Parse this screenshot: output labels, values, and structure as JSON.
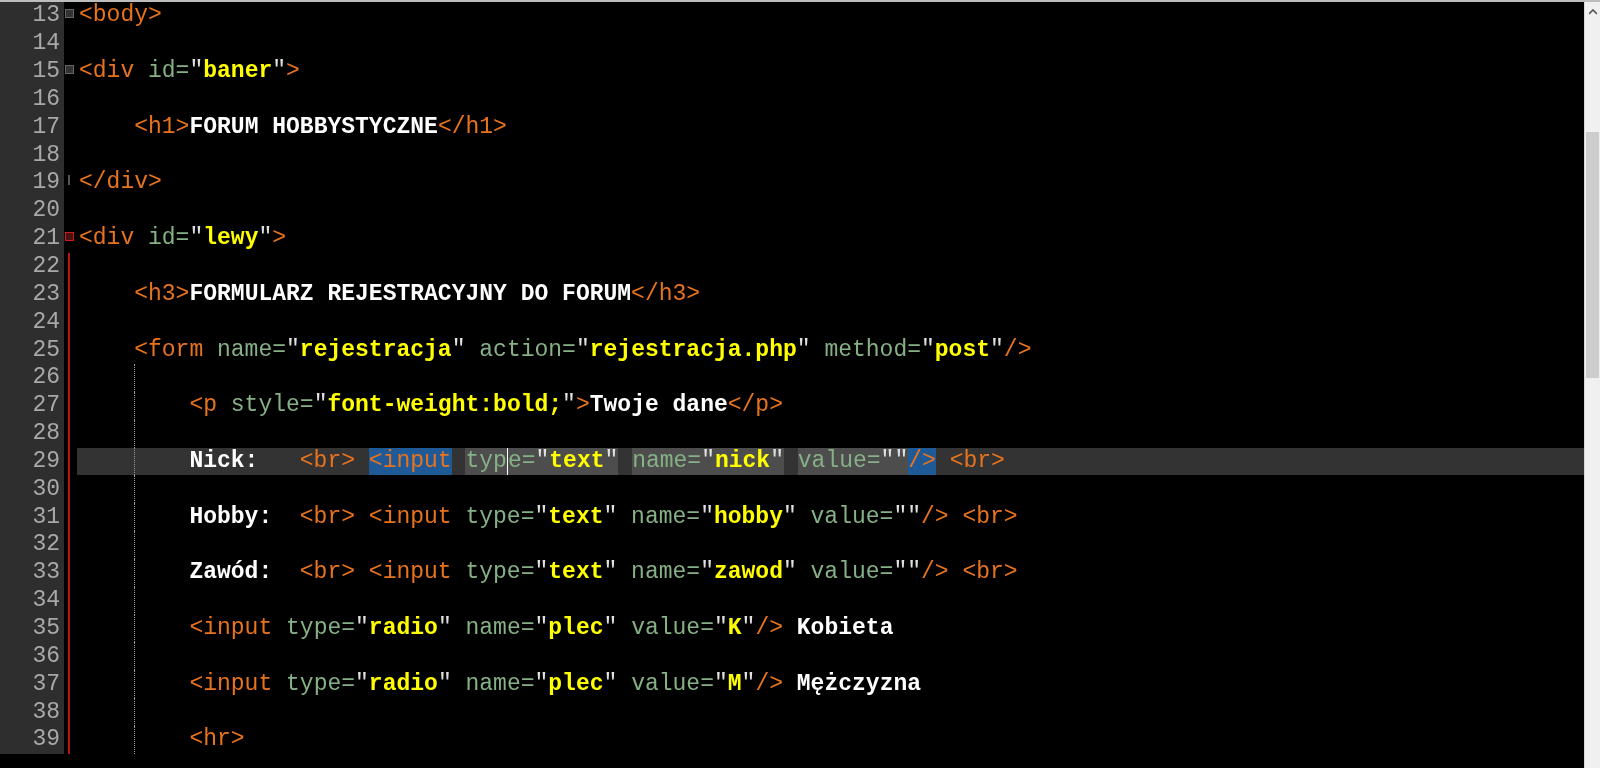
{
  "editor": {
    "lines": [
      {
        "number": "13",
        "kind": "flush",
        "marker": {
          "kind": "fold-start"
        },
        "current": false,
        "guide": false,
        "tokens": [
          {
            "kind": "tag",
            "text": "<body>"
          }
        ]
      },
      {
        "number": "14",
        "current": false,
        "guide": false
      },
      {
        "number": "15",
        "kind": "flush",
        "marker": {
          "kind": "fold-start"
        },
        "current": false,
        "guide": false,
        "tokens": [
          {
            "kind": "tag",
            "text": "<div"
          },
          {
            "kind": "attr",
            "text": "id=",
            "space_before": true
          },
          {
            "kind": "quote",
            "text": "\""
          },
          {
            "kind": "string",
            "text": "baner"
          },
          {
            "kind": "quote",
            "text": "\""
          },
          {
            "kind": "tag",
            "text": ">"
          }
        ]
      },
      {
        "number": "16",
        "current": false,
        "guide": false
      },
      {
        "number": "17",
        "kind": "indented",
        "current": false,
        "guide": false,
        "tokens": [
          {
            "kind": "tag",
            "text": "<h1>"
          },
          {
            "kind": "text",
            "text": "FORUM HOBBYSTYCZNE"
          },
          {
            "kind": "tag",
            "text": "</h1>"
          }
        ]
      },
      {
        "number": "18",
        "current": false,
        "guide": false
      },
      {
        "number": "19",
        "kind": "flush",
        "marker": {
          "kind": "fold-end"
        },
        "current": false,
        "guide": false,
        "tokens": [
          {
            "kind": "tag",
            "text": "</div>"
          }
        ]
      },
      {
        "number": "20",
        "current": false,
        "guide": false
      },
      {
        "number": "21",
        "kind": "flush",
        "marker": {
          "kind": "fold-start-active"
        },
        "current": false,
        "guide": false,
        "tokens": [
          {
            "kind": "tag",
            "text": "<div"
          },
          {
            "kind": "attr",
            "text": "id=",
            "space_before": true
          },
          {
            "kind": "quote",
            "text": "\""
          },
          {
            "kind": "string",
            "text": "lewy"
          },
          {
            "kind": "quote",
            "text": "\""
          },
          {
            "kind": "tag",
            "text": ">"
          }
        ]
      },
      {
        "number": "22",
        "marker": {
          "kind": "fold-body-active"
        },
        "current": false,
        "guide": false
      },
      {
        "number": "23",
        "kind": "indented",
        "marker": {
          "kind": "fold-body-active"
        },
        "current": false,
        "guide": false,
        "tokens": [
          {
            "kind": "tag",
            "text": "<h3>"
          },
          {
            "kind": "text",
            "text": "FORMULARZ REJESTRACYJNY DO FORUM"
          },
          {
            "kind": "tag",
            "text": "</h3>"
          }
        ]
      },
      {
        "number": "24",
        "marker": {
          "kind": "fold-body-active"
        },
        "current": false,
        "guide": false
      },
      {
        "number": "25",
        "kind": "indented",
        "marker": {
          "kind": "fold-body-active"
        },
        "current": false,
        "guide": false,
        "tokens": [
          {
            "kind": "tag",
            "text": "<form"
          },
          {
            "kind": "attr",
            "text": "name=",
            "space_before": true
          },
          {
            "kind": "quote",
            "text": "\""
          },
          {
            "kind": "string",
            "text": "rejestracja"
          },
          {
            "kind": "quote",
            "text": "\""
          },
          {
            "kind": "attr",
            "text": "action=",
            "space_before": true
          },
          {
            "kind": "quote",
            "text": "\""
          },
          {
            "kind": "string",
            "text": "rejestracja.php"
          },
          {
            "kind": "quote",
            "text": "\""
          },
          {
            "kind": "attr",
            "text": "method=",
            "space_before": true
          },
          {
            "kind": "quote",
            "text": "\""
          },
          {
            "kind": "string",
            "text": "post"
          },
          {
            "kind": "quote",
            "text": "\""
          },
          {
            "kind": "tag",
            "text": "/>"
          }
        ]
      },
      {
        "number": "26",
        "marker": {
          "kind": "fold-body-active"
        },
        "current": false,
        "guide": true
      },
      {
        "number": "27",
        "kind": "nested",
        "marker": {
          "kind": "fold-body-active"
        },
        "current": false,
        "guide": true,
        "tokens": [
          {
            "kind": "tag",
            "text": "<p"
          },
          {
            "kind": "attr",
            "text": "style=",
            "space_before": true
          },
          {
            "kind": "quote",
            "text": "\""
          },
          {
            "kind": "string",
            "text": "font-weight:bold;"
          },
          {
            "kind": "quote",
            "text": "\""
          },
          {
            "kind": "tag",
            "text": ">"
          },
          {
            "kind": "text",
            "text": "Twoje dane"
          },
          {
            "kind": "tag",
            "text": "</p>"
          }
        ]
      },
      {
        "number": "28",
        "marker": {
          "kind": "fold-body-active"
        },
        "current": false,
        "guide": true
      },
      {
        "number": "29",
        "kind": "nested",
        "marker": {
          "kind": "fold-body-active"
        },
        "current": true,
        "guide": true,
        "tokens": [
          {
            "kind": "label",
            "text": "Nick:"
          },
          {
            "kind": "tag",
            "text": "<br>"
          },
          {
            "kind": "tag",
            "text": "<input",
            "space_before": true,
            "matched": true
          },
          {
            "kind": "attr",
            "text": "typ",
            "space_before": true,
            "highlighted": true,
            "caret": true
          },
          {
            "kind": "attr",
            "text": "e=",
            "highlighted": true
          },
          {
            "kind": "quote",
            "text": "\"",
            "highlighted": true
          },
          {
            "kind": "string",
            "text": "text",
            "highlighted": true
          },
          {
            "kind": "quote",
            "text": "\"",
            "highlighted": true
          },
          {
            "kind": "attr",
            "text": "name=",
            "space_before": true,
            "highlighted": true
          },
          {
            "kind": "quote",
            "text": "\"",
            "highlighted": true
          },
          {
            "kind": "string",
            "text": "nick",
            "highlighted": true
          },
          {
            "kind": "quote",
            "text": "\"",
            "highlighted": true
          },
          {
            "kind": "attr",
            "text": "value=",
            "space_before": true,
            "highlighted": true
          },
          {
            "kind": "quote",
            "text": "\"\"",
            "highlighted": true
          },
          {
            "kind": "tag",
            "text": "/>",
            "matched": true
          },
          {
            "kind": "tag",
            "text": "<br>",
            "space_before": true
          }
        ]
      },
      {
        "number": "30",
        "marker": {
          "kind": "fold-body-active"
        },
        "current": false,
        "guide": true
      },
      {
        "number": "31",
        "kind": "nested",
        "marker": {
          "kind": "fold-body-active"
        },
        "current": false,
        "guide": true,
        "tokens": [
          {
            "kind": "label",
            "text": "Hobby:"
          },
          {
            "kind": "tag",
            "text": "<br>"
          },
          {
            "kind": "tag",
            "text": "<input",
            "space_before": true
          },
          {
            "kind": "attr",
            "text": "type=",
            "space_before": true
          },
          {
            "kind": "quote",
            "text": "\""
          },
          {
            "kind": "string",
            "text": "text"
          },
          {
            "kind": "quote",
            "text": "\""
          },
          {
            "kind": "attr",
            "text": "name=",
            "space_before": true
          },
          {
            "kind": "quote",
            "text": "\""
          },
          {
            "kind": "string",
            "text": "hobby"
          },
          {
            "kind": "quote",
            "text": "\""
          },
          {
            "kind": "attr",
            "text": "value=",
            "space_before": true
          },
          {
            "kind": "quote",
            "text": "\"\""
          },
          {
            "kind": "tag",
            "text": "/>"
          },
          {
            "kind": "tag",
            "text": "<br>",
            "space_before": true
          }
        ]
      },
      {
        "number": "32",
        "marker": {
          "kind": "fold-body-active"
        },
        "current": false,
        "guide": true
      },
      {
        "number": "33",
        "kind": "nested",
        "marker": {
          "kind": "fold-body-active"
        },
        "current": false,
        "guide": true,
        "tokens": [
          {
            "kind": "label",
            "text": "Zawód:"
          },
          {
            "kind": "tag",
            "text": "<br>"
          },
          {
            "kind": "tag",
            "text": "<input",
            "space_before": true
          },
          {
            "kind": "attr",
            "text": "type=",
            "space_before": true
          },
          {
            "kind": "quote",
            "text": "\""
          },
          {
            "kind": "string",
            "text": "text"
          },
          {
            "kind": "quote",
            "text": "\""
          },
          {
            "kind": "attr",
            "text": "name=",
            "space_before": true
          },
          {
            "kind": "quote",
            "text": "\""
          },
          {
            "kind": "string",
            "text": "zawod"
          },
          {
            "kind": "quote",
            "text": "\""
          },
          {
            "kind": "attr",
            "text": "value=",
            "space_before": true
          },
          {
            "kind": "quote",
            "text": "\"\""
          },
          {
            "kind": "tag",
            "text": "/>"
          },
          {
            "kind": "tag",
            "text": "<br>",
            "space_before": true
          }
        ]
      },
      {
        "number": "34",
        "marker": {
          "kind": "fold-body-active"
        },
        "current": false,
        "guide": true
      },
      {
        "number": "35",
        "kind": "nested",
        "marker": {
          "kind": "fold-body-active"
        },
        "current": false,
        "guide": true,
        "tokens": [
          {
            "kind": "tag",
            "text": "<input"
          },
          {
            "kind": "attr",
            "text": "type=",
            "space_before": true
          },
          {
            "kind": "quote",
            "text": "\""
          },
          {
            "kind": "string",
            "text": "radio"
          },
          {
            "kind": "quote",
            "text": "\""
          },
          {
            "kind": "attr",
            "text": "name=",
            "space_before": true
          },
          {
            "kind": "quote",
            "text": "\""
          },
          {
            "kind": "string",
            "text": "plec"
          },
          {
            "kind": "quote",
            "text": "\""
          },
          {
            "kind": "attr",
            "text": "value=",
            "space_before": true
          },
          {
            "kind": "quote",
            "text": "\""
          },
          {
            "kind": "string",
            "text": "K"
          },
          {
            "kind": "quote",
            "text": "\""
          },
          {
            "kind": "tag",
            "text": "/>"
          },
          {
            "kind": "text",
            "text": "Kobieta",
            "space_before": true
          }
        ]
      },
      {
        "number": "36",
        "marker": {
          "kind": "fold-body-active"
        },
        "current": false,
        "guide": true
      },
      {
        "number": "37",
        "kind": "nested",
        "marker": {
          "kind": "fold-body-active"
        },
        "current": false,
        "guide": true,
        "tokens": [
          {
            "kind": "tag",
            "text": "<input"
          },
          {
            "kind": "attr",
            "text": "type=",
            "space_before": true
          },
          {
            "kind": "quote",
            "text": "\""
          },
          {
            "kind": "string",
            "text": "radio"
          },
          {
            "kind": "quote",
            "text": "\""
          },
          {
            "kind": "attr",
            "text": "name=",
            "space_before": true
          },
          {
            "kind": "quote",
            "text": "\""
          },
          {
            "kind": "string",
            "text": "plec"
          },
          {
            "kind": "quote",
            "text": "\""
          },
          {
            "kind": "attr",
            "text": "value=",
            "space_before": true
          },
          {
            "kind": "quote",
            "text": "\""
          },
          {
            "kind": "string",
            "text": "M"
          },
          {
            "kind": "quote",
            "text": "\""
          },
          {
            "kind": "tag",
            "text": "/>"
          },
          {
            "kind": "text",
            "text": "Mężczyzna",
            "space_before": true
          }
        ]
      },
      {
        "number": "38",
        "marker": {
          "kind": "fold-body-active"
        },
        "current": false,
        "guide": true
      },
      {
        "number": "39",
        "kind": "nested",
        "marker": {
          "kind": "fold-body-active"
        },
        "current": false,
        "guide": true,
        "tokens": [
          {
            "kind": "tag",
            "text": "<hr>"
          }
        ]
      }
    ]
  }
}
